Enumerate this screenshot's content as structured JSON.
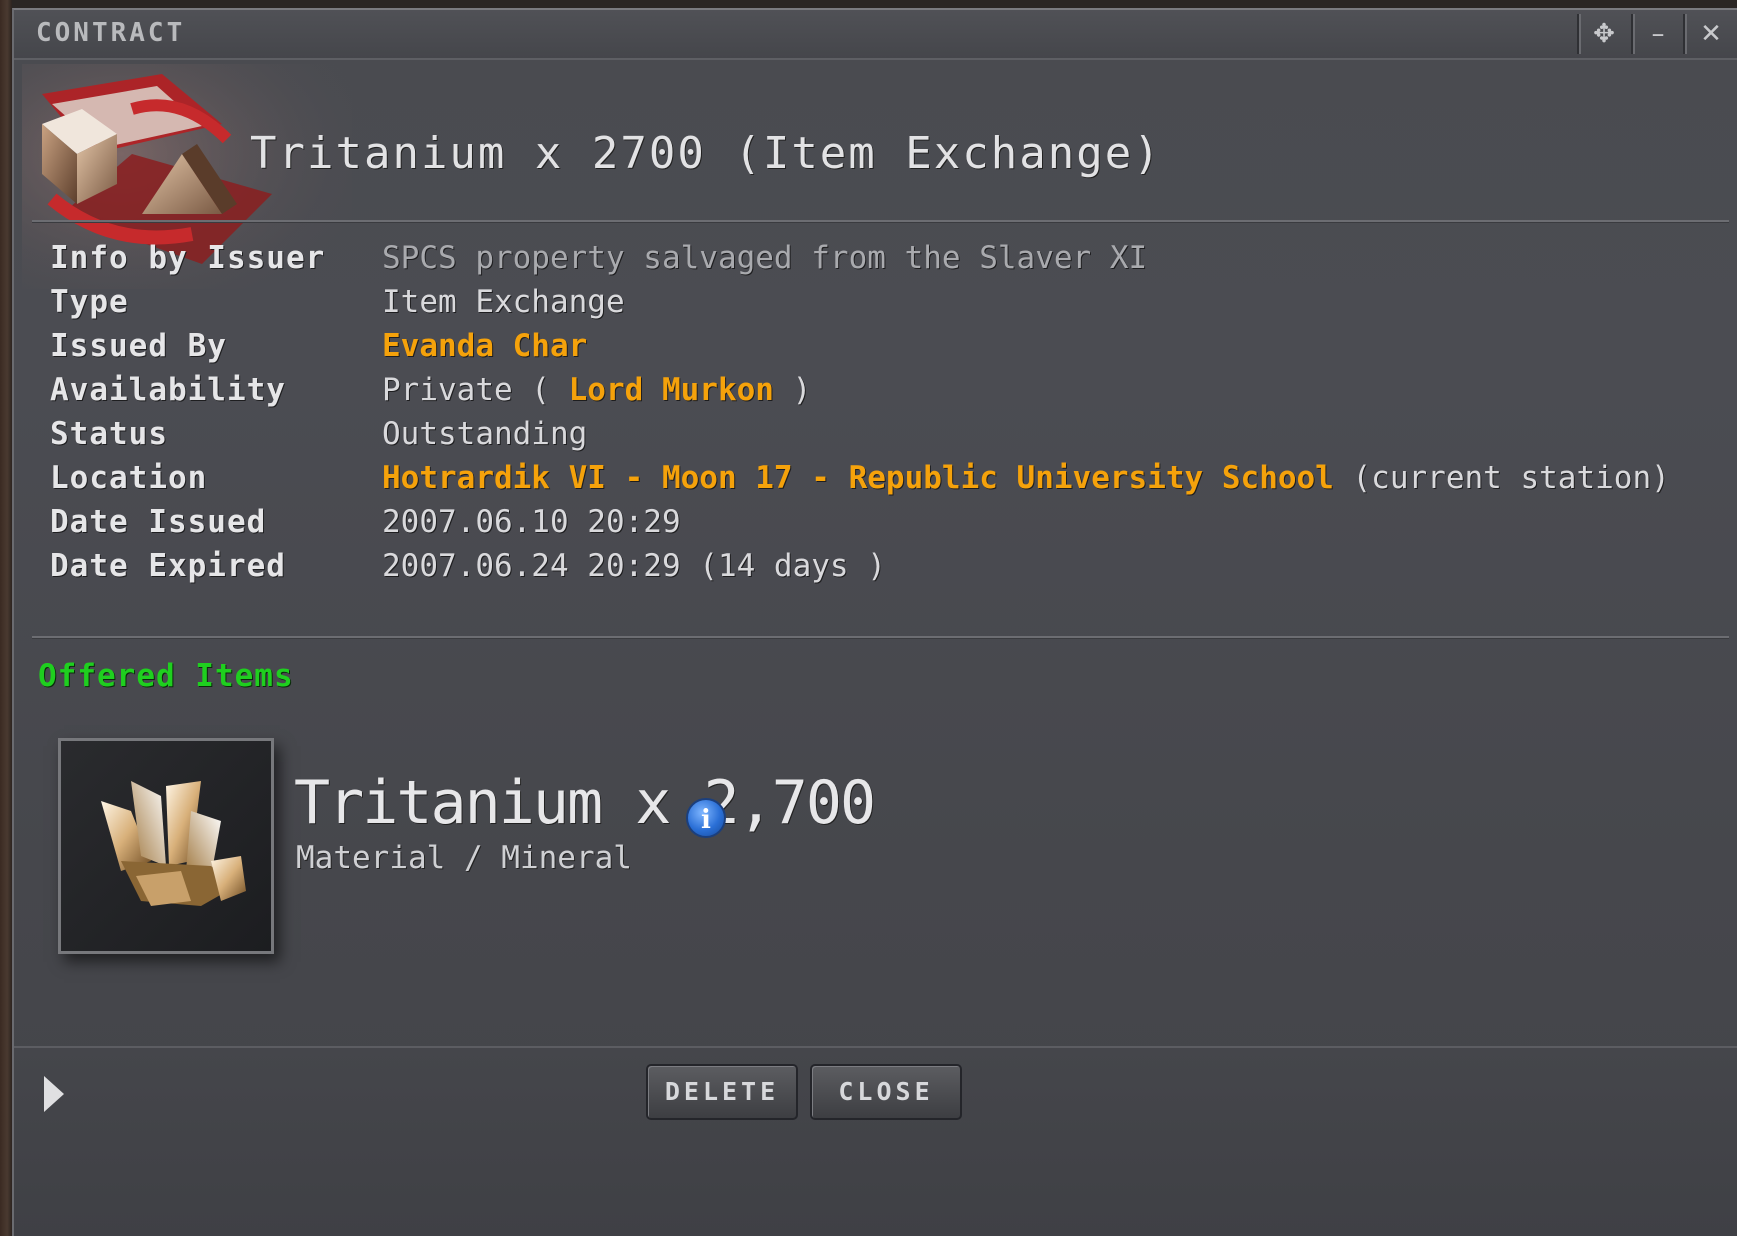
{
  "window": {
    "title": "CONTRACT",
    "controls": {
      "pin": "✥",
      "minimize": "–",
      "close": "✕"
    }
  },
  "header": {
    "title": "Tritanium x 2700 (Item Exchange)"
  },
  "details": [
    {
      "label": "Info by Issuer",
      "value": "SPCS property salvaged from the Slaver XI"
    },
    {
      "label": "Type",
      "value": "Item Exchange"
    },
    {
      "label": "Issued By",
      "value": "Evanda Char"
    },
    {
      "label": "Availability",
      "prefix": "Private ( ",
      "link": "Lord Murkon",
      "suffix": " )"
    },
    {
      "label": "Status",
      "value": "Outstanding"
    },
    {
      "label": "Location",
      "link": "Hotrardik VI - Moon 17 - Republic University School",
      "suffix": " (current station)"
    },
    {
      "label": "Date Issued",
      "value": "2007.06.10 20:29"
    },
    {
      "label": "Date Expired",
      "value": "2007.06.24 20:29 (14 days )"
    }
  ],
  "offered": {
    "heading": "Offered Items",
    "item": {
      "name": "Tritanium x 2,700",
      "category": "Material / Mineral",
      "info_icon": "i"
    }
  },
  "footer": {
    "delete_label": "DELETE",
    "close_label": "CLOSE"
  },
  "colors": {
    "link": "#f5a20b",
    "offered_heading": "#1fcf1f",
    "window_bg": "#4a4b50"
  }
}
